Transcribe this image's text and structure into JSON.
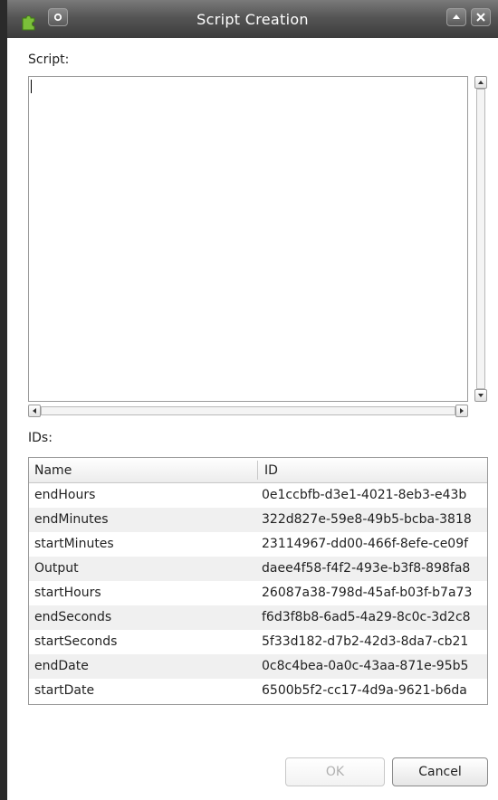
{
  "window": {
    "title": "Script Creation",
    "icons": {
      "app": "puzzle-icon",
      "menu": "window-menu-icon",
      "maximize": "maximize-icon",
      "close": "close-icon"
    }
  },
  "script": {
    "label": "Script:",
    "value": ""
  },
  "ids": {
    "label": "IDs:",
    "columns": {
      "name": "Name",
      "id": "ID"
    },
    "rows": [
      {
        "name": "endHours",
        "id": "0e1ccbfb-d3e1-4021-8eb3-e43b"
      },
      {
        "name": "endMinutes",
        "id": "322d827e-59e8-49b5-bcba-3818"
      },
      {
        "name": "startMinutes",
        "id": "23114967-dd00-466f-8efe-ce09f"
      },
      {
        "name": "Output",
        "id": "daee4f58-f4f2-493e-b3f8-898fa8"
      },
      {
        "name": "startHours",
        "id": "26087a38-798d-45af-b03f-b7a73"
      },
      {
        "name": "endSeconds",
        "id": "f6d3f8b8-6ad5-4a29-8c0c-3d2c8"
      },
      {
        "name": "startSeconds",
        "id": "5f33d182-d7b2-42d3-8da7-cb21"
      },
      {
        "name": "endDate",
        "id": "0c8c4bea-0a0c-43aa-871e-95b5"
      },
      {
        "name": "startDate",
        "id": "6500b5f2-cc17-4d9a-9621-b6da"
      }
    ]
  },
  "buttons": {
    "ok": "OK",
    "cancel": "Cancel"
  },
  "colors": {
    "titlebar": "#555555",
    "disabled_text": "#b0b0b0",
    "row_alt": "#f0f0f0"
  }
}
